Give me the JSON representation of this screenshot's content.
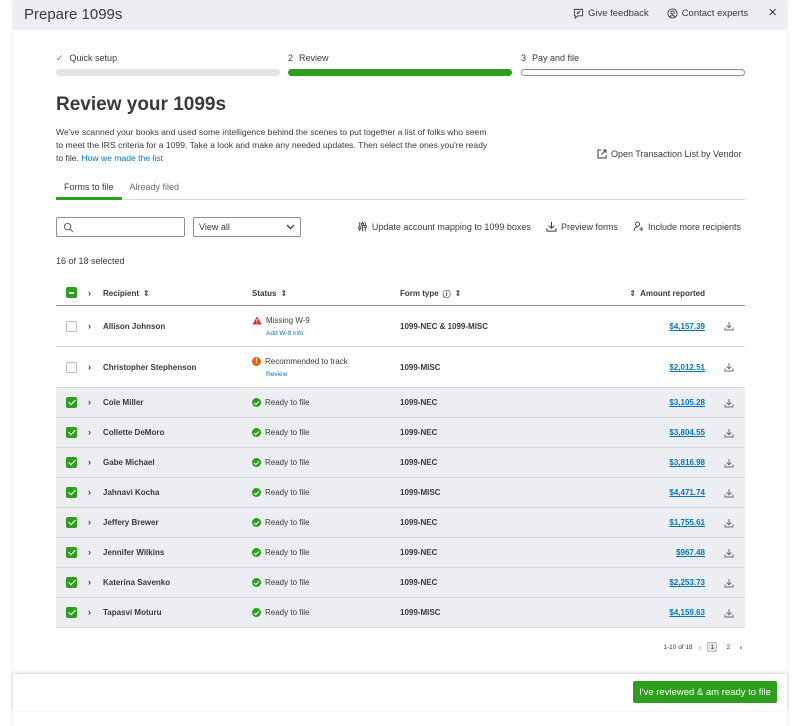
{
  "window": {
    "title": "Prepare 1099s"
  },
  "top_actions": {
    "feedback": "Give feedback",
    "contact": "Contact experts",
    "close": "×"
  },
  "stepper": [
    {
      "number": "✓",
      "label": "Quick setup",
      "state": "done"
    },
    {
      "number": "2",
      "label": "Review",
      "state": "active"
    },
    {
      "number": "3",
      "label": "Pay and file",
      "state": "todo"
    }
  ],
  "page": {
    "title": "Review your 1099s",
    "intro": "We've scanned your books and used some intelligence behind the scenes to put together a list of folks who seem to meet the IRS criteria for a 1099. Take a look and make any needed updates. Then select the ones you're ready to file.",
    "intro_link": "How we made the list",
    "open_transactions": "Open Transaction List by Vendor"
  },
  "tabs": [
    {
      "label": "Forms to file",
      "active": true
    },
    {
      "label": "Already filed",
      "active": false
    }
  ],
  "toolbar": {
    "search_value": "",
    "search_placeholder": "",
    "view_value": "View all",
    "update_mapping": "Update account mapping to 1099 boxes",
    "preview_forms": "Preview forms",
    "include_more": "Include more recipients"
  },
  "selected_text": "16 of 18 selected",
  "table": {
    "headers": {
      "recipient": "Recipient",
      "status": "Status",
      "form_type": "Form type",
      "amount": "Amount reported"
    },
    "rows": [
      {
        "recipient": "Allison Johnson",
        "status": "Missing W-9",
        "status_link": "Add W-9 info",
        "status_kind": "warn",
        "form": "1099-NEC & 1099-MISC",
        "amount": "$4,157.39",
        "selected": false
      },
      {
        "recipient": "Christopher Stephenson",
        "status": "Recommended to track",
        "status_link": "Review",
        "status_kind": "rec",
        "form": "1099-MISC",
        "amount": "$2,012.51",
        "selected": false
      },
      {
        "recipient": "Cole Miller",
        "status": "Ready to file",
        "status_link": "",
        "status_kind": "ok",
        "form": "1099-NEC",
        "amount": "$3,105.28",
        "selected": true
      },
      {
        "recipient": "Collette DeMoro",
        "status": "Ready to file",
        "status_link": "",
        "status_kind": "ok",
        "form": "1099-NEC",
        "amount": "$3,804.55",
        "selected": true
      },
      {
        "recipient": "Gabe Michael",
        "status": "Ready to file",
        "status_link": "",
        "status_kind": "ok",
        "form": "1099-NEC",
        "amount": "$3,816.98",
        "selected": true
      },
      {
        "recipient": "Jahnavi Kocha",
        "status": "Ready to file",
        "status_link": "",
        "status_kind": "ok",
        "form": "1099-MISC",
        "amount": "$4,471.74",
        "selected": true
      },
      {
        "recipient": "Jeffery Brewer",
        "status": "Ready to file",
        "status_link": "",
        "status_kind": "ok",
        "form": "1099-NEC",
        "amount": "$1,755.61",
        "selected": true
      },
      {
        "recipient": "Jennifer Wilkins",
        "status": "Ready to file",
        "status_link": "",
        "status_kind": "ok",
        "form": "1099-NEC",
        "amount": "$967.48",
        "selected": true
      },
      {
        "recipient": "Katerina Savenko",
        "status": "Ready to file",
        "status_link": "",
        "status_kind": "ok",
        "form": "1099-NEC",
        "amount": "$2,253.73",
        "selected": true
      },
      {
        "recipient": "Tapasvi Moturu",
        "status": "Ready to file",
        "status_link": "",
        "status_kind": "ok",
        "form": "1099-MISC",
        "amount": "$4,159.63",
        "selected": true
      }
    ]
  },
  "pagination": {
    "range": "1-10 of 18",
    "pages": [
      "1",
      "2"
    ],
    "current": "1",
    "prev": "‹",
    "next": "›"
  },
  "footer": {
    "primary": "I've reviewed & am ready to file"
  },
  "colors": {
    "accent": "#2ca01c",
    "link": "#0077c5",
    "warn": "#d52b1e",
    "recommend": "#ec6608"
  }
}
